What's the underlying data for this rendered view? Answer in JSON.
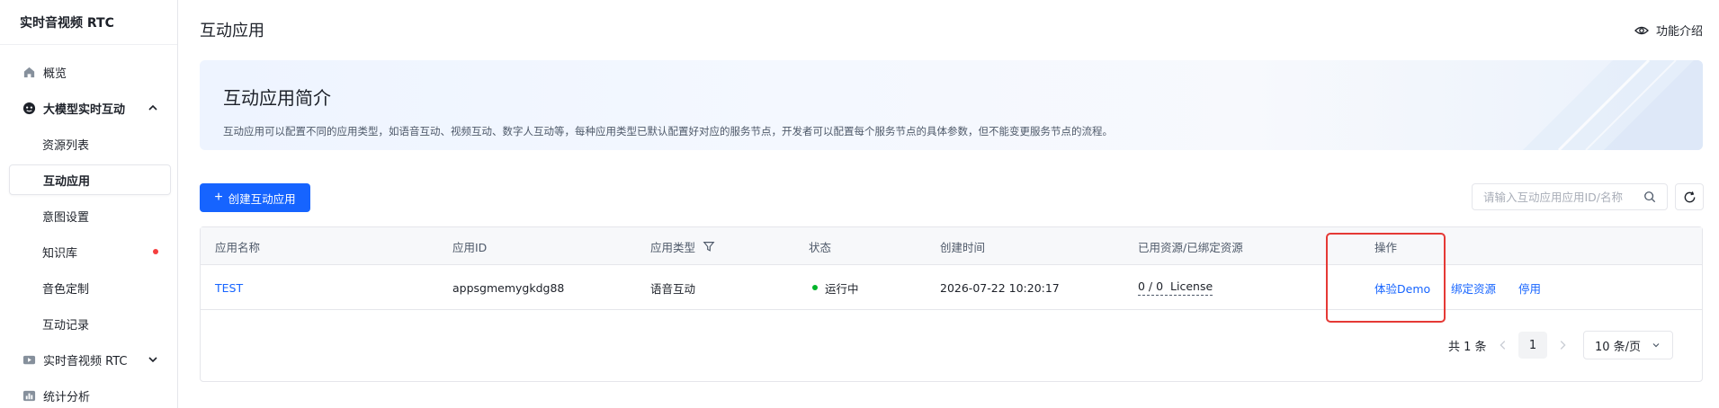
{
  "sidebar": {
    "product_title": "实时音视频 RTC",
    "items": [
      {
        "label": "概览",
        "icon": "home-icon"
      },
      {
        "label": "大模型实时互动",
        "icon": "ai-face-icon"
      },
      {
        "label": "资源列表"
      },
      {
        "label": "互动应用"
      },
      {
        "label": "意图设置"
      },
      {
        "label": "知识库"
      },
      {
        "label": "音色定制"
      },
      {
        "label": "互动记录"
      },
      {
        "label": "实时音视频 RTC",
        "icon": "video-icon"
      },
      {
        "label": "统计分析",
        "icon": "chart-icon"
      }
    ]
  },
  "header": {
    "title": "互动应用",
    "feature_intro": "功能介绍"
  },
  "banner": {
    "title": "互动应用简介",
    "description": "互动应用可以配置不同的应用类型，如语音互动、视频互动、数字人互动等，每种应用类型已默认配置好对应的服务节点，开发者可以配置每个服务节点的具体参数，但不能变更服务节点的流程。"
  },
  "toolbar": {
    "create_label": "创建互动应用",
    "search_placeholder": "请输入互动应用应用ID/名称"
  },
  "table": {
    "columns": [
      "应用名称",
      "应用ID",
      "应用类型",
      "状态",
      "创建时间",
      "已用资源/已绑定资源",
      "操作"
    ],
    "rows": [
      {
        "name": "TEST",
        "app_id": "appsgmemygkdg88",
        "type": "语音互动",
        "status": "运行中",
        "created": "2026-07-22 10:20:17",
        "resource_count": "0 / 0",
        "resource_unit": "License",
        "actions": [
          "体验Demo",
          "绑定资源",
          "停用"
        ]
      }
    ]
  },
  "pagination": {
    "total": "共 1 条",
    "current_page": "1",
    "page_size": "10 条/页"
  },
  "colors": {
    "primary": "#1664ff",
    "running": "#00b42a",
    "highlight": "#e53935",
    "alert_dot": "#f53f3f"
  }
}
